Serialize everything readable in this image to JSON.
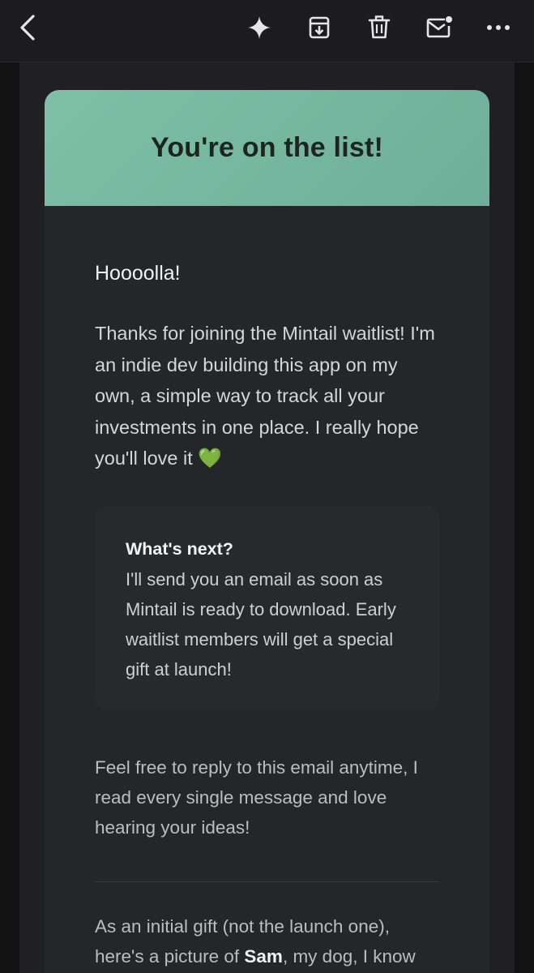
{
  "toolbar": {
    "back_icon": "chevron-left-icon",
    "ai_icon": "sparkle-icon",
    "archive_icon": "archive-icon",
    "delete_icon": "trash-icon",
    "mark_unread_icon": "mail-unread-icon",
    "more_icon": "more-horizontal-icon"
  },
  "email": {
    "hero_title": "You're on the list!",
    "greeting": "Hoooolla!",
    "intro": "Thanks for joining the Mintail waitlist! I'm an indie dev building this app on my own, a simple way to track all your investments in one place. I really hope you'll love it",
    "intro_emoji": "💚",
    "next": {
      "title": "What's next?",
      "text": "I'll send you an email as soon as Mintail is ready to download. Early waitlist members will get a special gift at launch!"
    },
    "reply_note": "Feel free to reply to this email anytime, I read every single message and love hearing your ideas!",
    "gift_prefix": "As an initial gift (not the launch one), here's a picture of ",
    "gift_name": "Sam",
    "gift_suffix": ", my dog, I know it's not a cat but it's cute:"
  },
  "colors": {
    "hero_bg": "#7ebfa8",
    "card_bg": "#252629",
    "page_bg": "#121213",
    "heart": "#7ed957"
  }
}
